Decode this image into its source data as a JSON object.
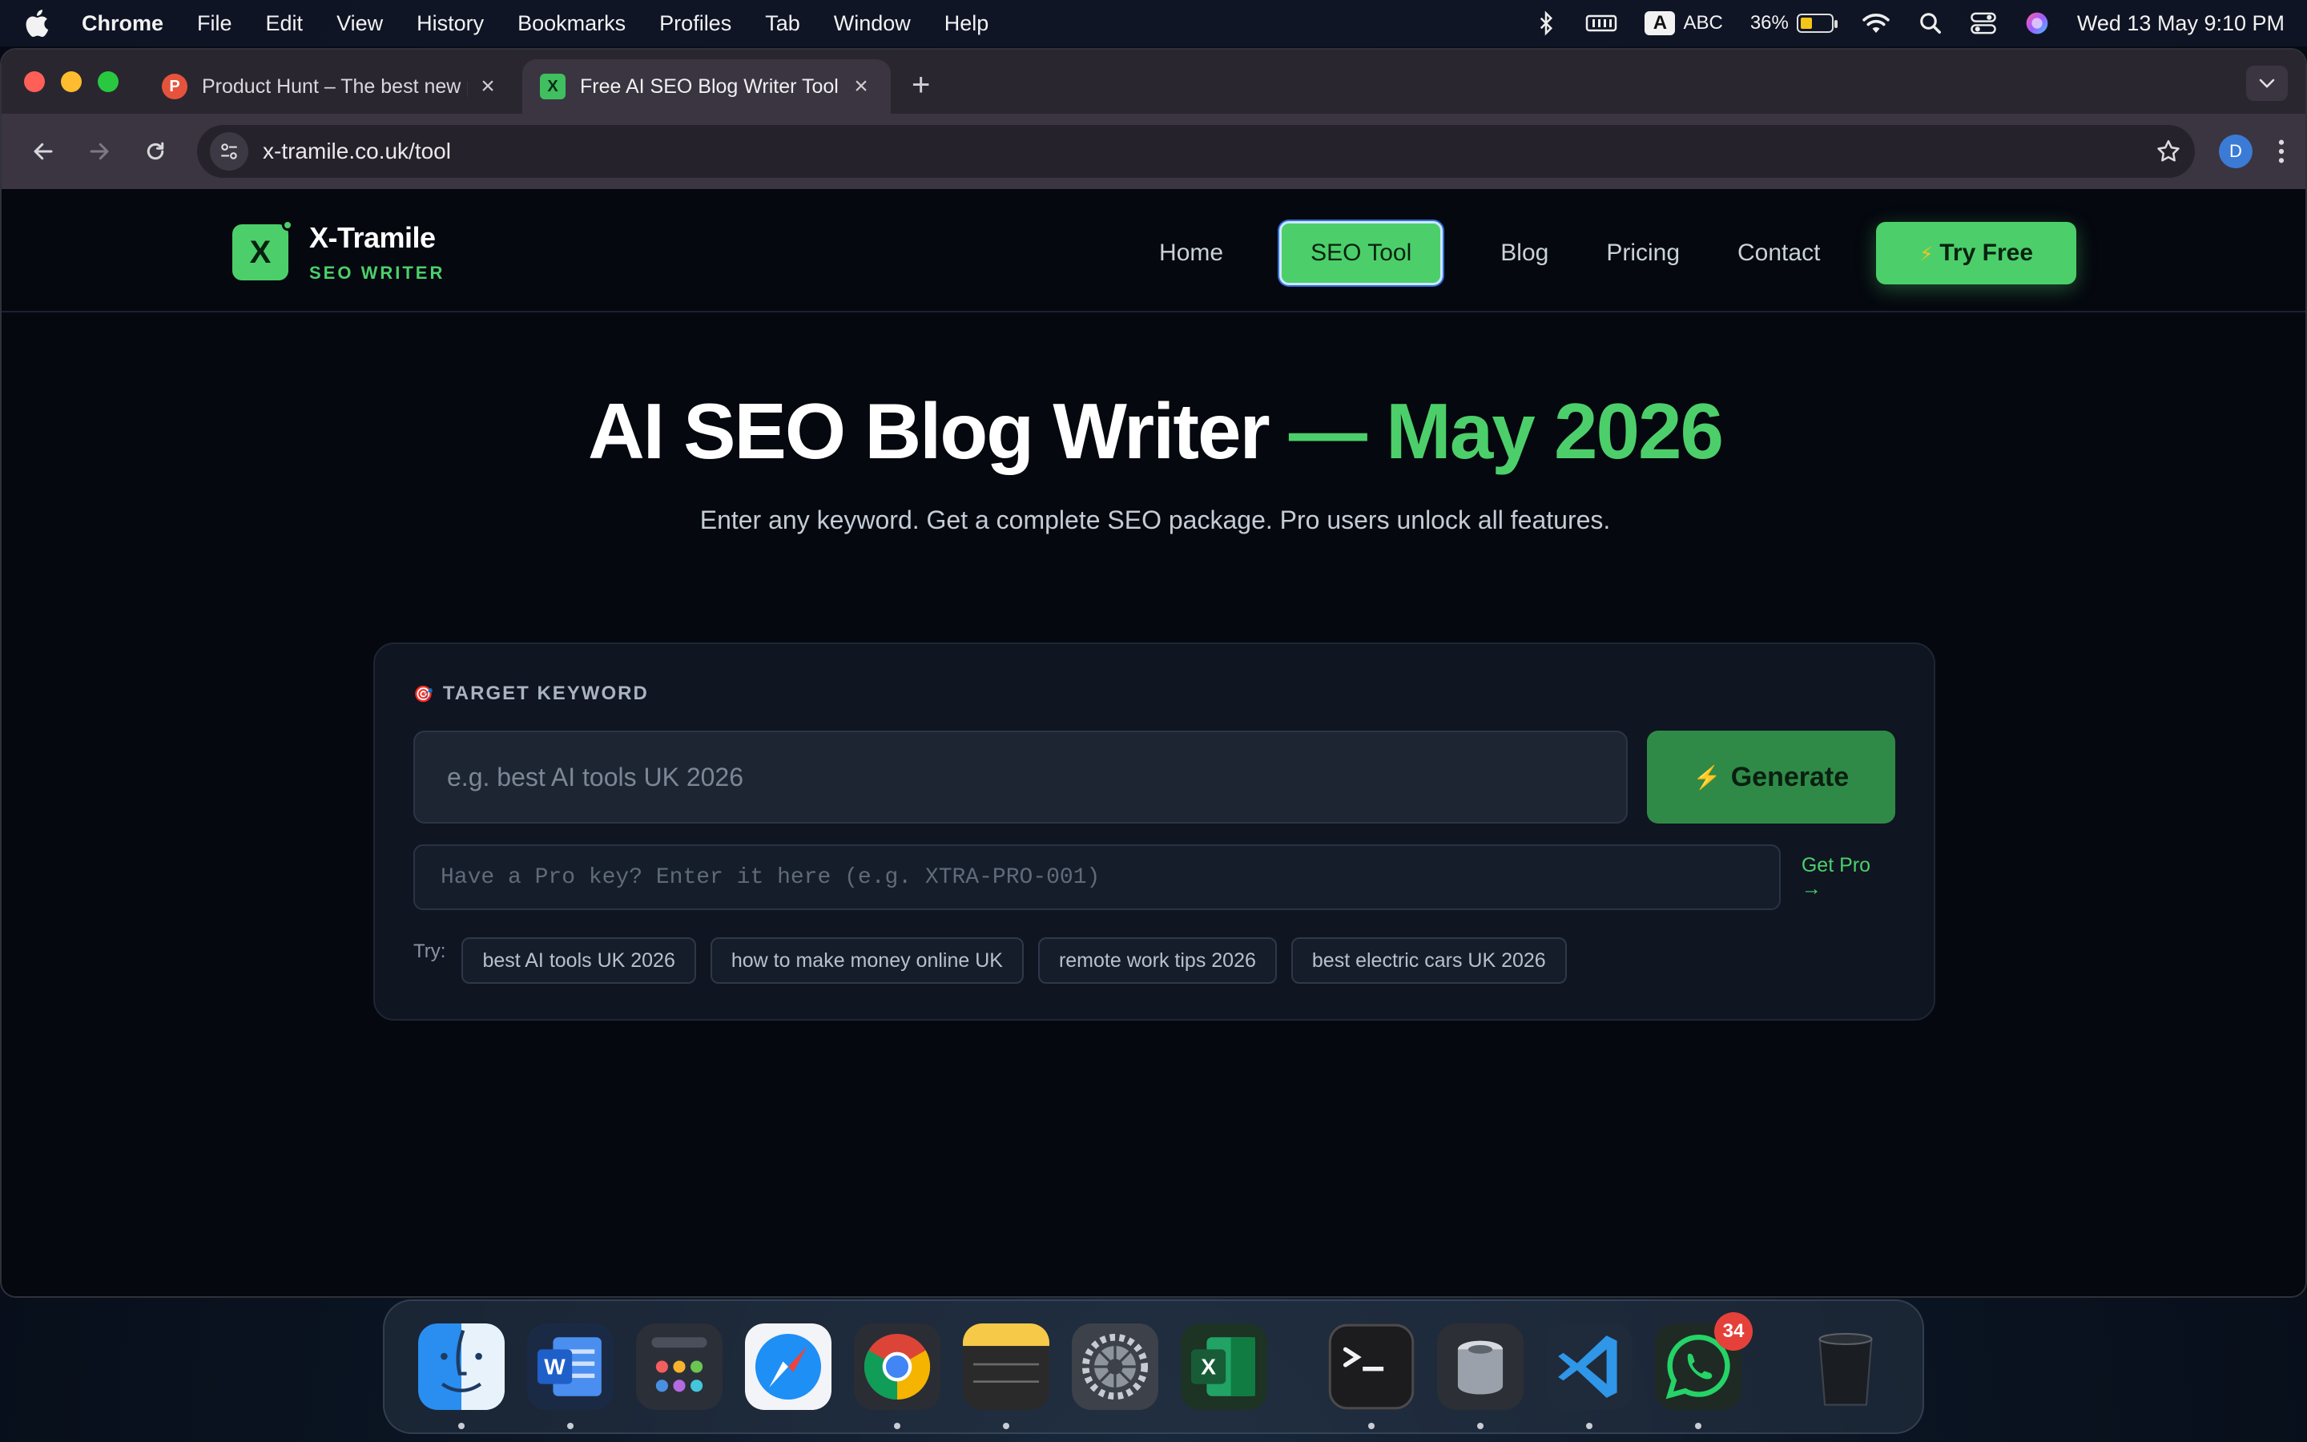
{
  "menubar": {
    "app_name": "Chrome",
    "menus": [
      "File",
      "Edit",
      "View",
      "History",
      "Bookmarks",
      "Profiles",
      "Tab",
      "Window",
      "Help"
    ],
    "input_badge": "A",
    "input_source": "ABC",
    "battery_percent": "36%",
    "battery_level": 0.36,
    "datetime": "Wed 13 May  9:10 PM"
  },
  "browser": {
    "tabs": [
      {
        "title": "Product Hunt – The best new products",
        "favicon_letter": "P",
        "active": false
      },
      {
        "title": "Free AI SEO Blog Writer Tool | X-Tramile",
        "favicon_letter": "X",
        "active": true
      }
    ],
    "new_tab_label": "+",
    "url": "x-tramile.co.uk/tool",
    "profile_initial": "D"
  },
  "site": {
    "logo_letter": "X",
    "brand_name": "X-Tramile",
    "brand_tagline": "SEO WRITER",
    "nav": [
      {
        "label": "Home",
        "active": false
      },
      {
        "label": "SEO Tool",
        "active": true
      },
      {
        "label": "Blog",
        "active": false
      },
      {
        "label": "Pricing",
        "active": false
      },
      {
        "label": "Contact",
        "active": false
      }
    ],
    "cta_label": "Try Free",
    "accent_color": "#4ccf6a"
  },
  "hero": {
    "title_main": "AI SEO Blog Writer",
    "title_accent": "— May 2026",
    "subtitle": "Enter any keyword. Get a complete SEO package. Pro users unlock all features."
  },
  "tool": {
    "keyword_label": "TARGET KEYWORD",
    "keyword_placeholder": "e.g. best AI tools UK 2026",
    "generate_label": "Generate",
    "pro_key_placeholder": "Have a Pro key? Enter it here (e.g. XTRA-PRO-001)",
    "get_pro_label": "Get Pro →",
    "try_label": "Try:",
    "suggestions": [
      "best AI tools UK 2026",
      "how to make money online UK",
      "remote work tips 2026",
      "best electric cars UK 2026"
    ]
  },
  "dock": {
    "apps": [
      "Finder",
      "Microsoft Word",
      "Launchpad",
      "Safari",
      "Google Chrome",
      "Notes",
      "System Settings",
      "Microsoft Excel",
      "Terminal",
      "Disk Utility",
      "Visual Studio Code",
      "WhatsApp",
      "Trash"
    ],
    "whatsapp_badge": "34"
  }
}
